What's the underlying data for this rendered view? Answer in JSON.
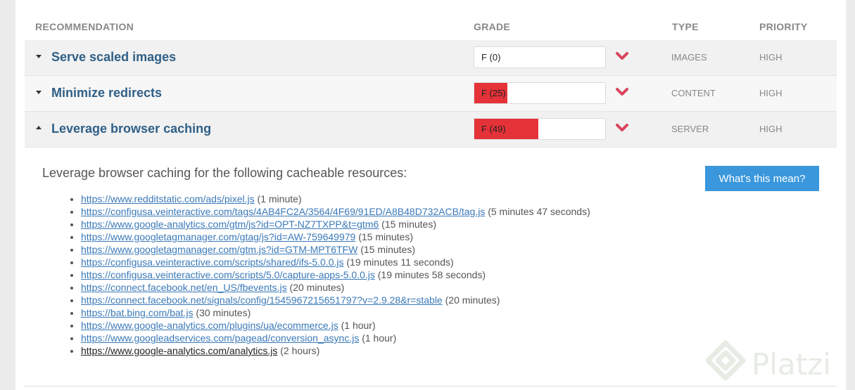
{
  "header": {
    "recommendation": "RECOMMENDATION",
    "grade": "GRADE",
    "type": "TYPE",
    "priority": "PRIORITY"
  },
  "rows": [
    {
      "title": "Serve scaled images",
      "grade_label": "F (0)",
      "grade_value": 0,
      "type": "IMAGES",
      "priority": "HIGH",
      "expanded": false
    },
    {
      "title": "Minimize redirects",
      "grade_label": "F (25)",
      "grade_value": 25,
      "type": "CONTENT",
      "priority": "HIGH",
      "expanded": false
    },
    {
      "title": "Leverage browser caching",
      "grade_label": "F (49)",
      "grade_value": 49,
      "type": "SERVER",
      "priority": "HIGH",
      "expanded": true
    }
  ],
  "details": {
    "intro": "Leverage browser caching for the following cacheable resources:",
    "button_label": "What's this mean?",
    "resources": [
      {
        "url": "https://www.redditstatic.com/ads/pixel.js",
        "duration": "(1 minute)"
      },
      {
        "url": "https://configusa.veinteractive.com/tags/4AB4FC2A/3564/4F69/91ED/A8B48D732ACB/tag.js",
        "duration": "(5 minutes 47 seconds)"
      },
      {
        "url": "https://www.google-analytics.com/gtm/js?id=OPT-NZ7TXPP&t=gtm6",
        "duration": "(15 minutes)"
      },
      {
        "url": "https://www.googletagmanager.com/gtag/js?id=AW-759649979",
        "duration": "(15 minutes)"
      },
      {
        "url": "https://www.googletagmanager.com/gtm.js?id=GTM-MPT6TFW",
        "duration": "(15 minutes)"
      },
      {
        "url": "https://configusa.veinteractive.com/scripts/shared/ifs-5.0.0.js",
        "duration": "(19 minutes 11 seconds)"
      },
      {
        "url": "https://configusa.veinteractive.com/scripts/5.0/capture-apps-5.0.0.js",
        "duration": "(19 minutes 58 seconds)"
      },
      {
        "url": "https://connect.facebook.net/en_US/fbevents.js",
        "duration": "(20 minutes)"
      },
      {
        "url": "https://connect.facebook.net/signals/config/1545967215651797?v=2.9.28&r=stable",
        "duration": "(20 minutes)"
      },
      {
        "url": "https://bat.bing.com/bat.js",
        "duration": "(30 minutes)"
      },
      {
        "url": "https://www.google-analytics.com/plugins/ua/ecommerce.js",
        "duration": "(1 hour)"
      },
      {
        "url": "https://www.googleadservices.com/pagead/conversion_async.js",
        "duration": "(1 hour)"
      },
      {
        "url": "https://www.google-analytics.com/analytics.js",
        "duration": "(2 hours)",
        "visited": true
      }
    ]
  },
  "colors": {
    "grade_fail": "#e53238",
    "chevron": "#d9455a",
    "link": "#3a79b8",
    "button": "#3a97db"
  },
  "watermark": {
    "text": "Platzi",
    "icon": "platzi-logo-icon"
  }
}
